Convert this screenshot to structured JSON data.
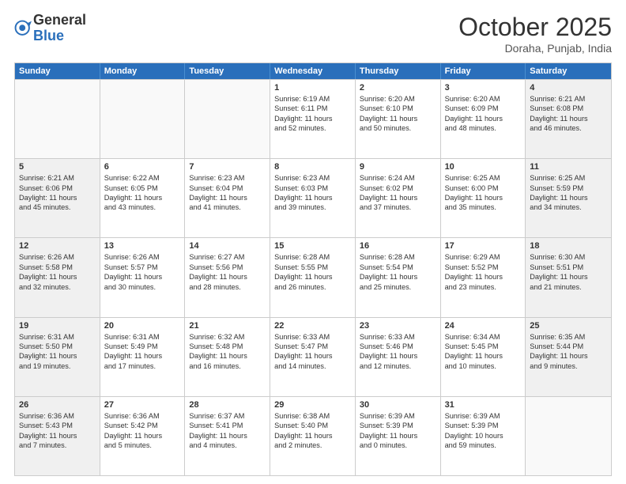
{
  "header": {
    "logo_general": "General",
    "logo_blue": "Blue",
    "month": "October 2025",
    "location": "Doraha, Punjab, India"
  },
  "weekdays": [
    "Sunday",
    "Monday",
    "Tuesday",
    "Wednesday",
    "Thursday",
    "Friday",
    "Saturday"
  ],
  "rows": [
    [
      {
        "day": "",
        "empty": true,
        "lines": []
      },
      {
        "day": "",
        "empty": true,
        "lines": []
      },
      {
        "day": "",
        "empty": true,
        "lines": []
      },
      {
        "day": "1",
        "empty": false,
        "lines": [
          "Sunrise: 6:19 AM",
          "Sunset: 6:11 PM",
          "Daylight: 11 hours",
          "and 52 minutes."
        ]
      },
      {
        "day": "2",
        "empty": false,
        "lines": [
          "Sunrise: 6:20 AM",
          "Sunset: 6:10 PM",
          "Daylight: 11 hours",
          "and 50 minutes."
        ]
      },
      {
        "day": "3",
        "empty": false,
        "lines": [
          "Sunrise: 6:20 AM",
          "Sunset: 6:09 PM",
          "Daylight: 11 hours",
          "and 48 minutes."
        ]
      },
      {
        "day": "4",
        "empty": false,
        "shaded": true,
        "lines": [
          "Sunrise: 6:21 AM",
          "Sunset: 6:08 PM",
          "Daylight: 11 hours",
          "and 46 minutes."
        ]
      }
    ],
    [
      {
        "day": "5",
        "empty": false,
        "shaded": true,
        "lines": [
          "Sunrise: 6:21 AM",
          "Sunset: 6:06 PM",
          "Daylight: 11 hours",
          "and 45 minutes."
        ]
      },
      {
        "day": "6",
        "empty": false,
        "lines": [
          "Sunrise: 6:22 AM",
          "Sunset: 6:05 PM",
          "Daylight: 11 hours",
          "and 43 minutes."
        ]
      },
      {
        "day": "7",
        "empty": false,
        "lines": [
          "Sunrise: 6:23 AM",
          "Sunset: 6:04 PM",
          "Daylight: 11 hours",
          "and 41 minutes."
        ]
      },
      {
        "day": "8",
        "empty": false,
        "lines": [
          "Sunrise: 6:23 AM",
          "Sunset: 6:03 PM",
          "Daylight: 11 hours",
          "and 39 minutes."
        ]
      },
      {
        "day": "9",
        "empty": false,
        "lines": [
          "Sunrise: 6:24 AM",
          "Sunset: 6:02 PM",
          "Daylight: 11 hours",
          "and 37 minutes."
        ]
      },
      {
        "day": "10",
        "empty": false,
        "lines": [
          "Sunrise: 6:25 AM",
          "Sunset: 6:00 PM",
          "Daylight: 11 hours",
          "and 35 minutes."
        ]
      },
      {
        "day": "11",
        "empty": false,
        "shaded": true,
        "lines": [
          "Sunrise: 6:25 AM",
          "Sunset: 5:59 PM",
          "Daylight: 11 hours",
          "and 34 minutes."
        ]
      }
    ],
    [
      {
        "day": "12",
        "empty": false,
        "shaded": true,
        "lines": [
          "Sunrise: 6:26 AM",
          "Sunset: 5:58 PM",
          "Daylight: 11 hours",
          "and 32 minutes."
        ]
      },
      {
        "day": "13",
        "empty": false,
        "lines": [
          "Sunrise: 6:26 AM",
          "Sunset: 5:57 PM",
          "Daylight: 11 hours",
          "and 30 minutes."
        ]
      },
      {
        "day": "14",
        "empty": false,
        "lines": [
          "Sunrise: 6:27 AM",
          "Sunset: 5:56 PM",
          "Daylight: 11 hours",
          "and 28 minutes."
        ]
      },
      {
        "day": "15",
        "empty": false,
        "lines": [
          "Sunrise: 6:28 AM",
          "Sunset: 5:55 PM",
          "Daylight: 11 hours",
          "and 26 minutes."
        ]
      },
      {
        "day": "16",
        "empty": false,
        "lines": [
          "Sunrise: 6:28 AM",
          "Sunset: 5:54 PM",
          "Daylight: 11 hours",
          "and 25 minutes."
        ]
      },
      {
        "day": "17",
        "empty": false,
        "lines": [
          "Sunrise: 6:29 AM",
          "Sunset: 5:52 PM",
          "Daylight: 11 hours",
          "and 23 minutes."
        ]
      },
      {
        "day": "18",
        "empty": false,
        "shaded": true,
        "lines": [
          "Sunrise: 6:30 AM",
          "Sunset: 5:51 PM",
          "Daylight: 11 hours",
          "and 21 minutes."
        ]
      }
    ],
    [
      {
        "day": "19",
        "empty": false,
        "shaded": true,
        "lines": [
          "Sunrise: 6:31 AM",
          "Sunset: 5:50 PM",
          "Daylight: 11 hours",
          "and 19 minutes."
        ]
      },
      {
        "day": "20",
        "empty": false,
        "lines": [
          "Sunrise: 6:31 AM",
          "Sunset: 5:49 PM",
          "Daylight: 11 hours",
          "and 17 minutes."
        ]
      },
      {
        "day": "21",
        "empty": false,
        "lines": [
          "Sunrise: 6:32 AM",
          "Sunset: 5:48 PM",
          "Daylight: 11 hours",
          "and 16 minutes."
        ]
      },
      {
        "day": "22",
        "empty": false,
        "lines": [
          "Sunrise: 6:33 AM",
          "Sunset: 5:47 PM",
          "Daylight: 11 hours",
          "and 14 minutes."
        ]
      },
      {
        "day": "23",
        "empty": false,
        "lines": [
          "Sunrise: 6:33 AM",
          "Sunset: 5:46 PM",
          "Daylight: 11 hours",
          "and 12 minutes."
        ]
      },
      {
        "day": "24",
        "empty": false,
        "lines": [
          "Sunrise: 6:34 AM",
          "Sunset: 5:45 PM",
          "Daylight: 11 hours",
          "and 10 minutes."
        ]
      },
      {
        "day": "25",
        "empty": false,
        "shaded": true,
        "lines": [
          "Sunrise: 6:35 AM",
          "Sunset: 5:44 PM",
          "Daylight: 11 hours",
          "and 9 minutes."
        ]
      }
    ],
    [
      {
        "day": "26",
        "empty": false,
        "shaded": true,
        "lines": [
          "Sunrise: 6:36 AM",
          "Sunset: 5:43 PM",
          "Daylight: 11 hours",
          "and 7 minutes."
        ]
      },
      {
        "day": "27",
        "empty": false,
        "lines": [
          "Sunrise: 6:36 AM",
          "Sunset: 5:42 PM",
          "Daylight: 11 hours",
          "and 5 minutes."
        ]
      },
      {
        "day": "28",
        "empty": false,
        "lines": [
          "Sunrise: 6:37 AM",
          "Sunset: 5:41 PM",
          "Daylight: 11 hours",
          "and 4 minutes."
        ]
      },
      {
        "day": "29",
        "empty": false,
        "lines": [
          "Sunrise: 6:38 AM",
          "Sunset: 5:40 PM",
          "Daylight: 11 hours",
          "and 2 minutes."
        ]
      },
      {
        "day": "30",
        "empty": false,
        "lines": [
          "Sunrise: 6:39 AM",
          "Sunset: 5:39 PM",
          "Daylight: 11 hours",
          "and 0 minutes."
        ]
      },
      {
        "day": "31",
        "empty": false,
        "lines": [
          "Sunrise: 6:39 AM",
          "Sunset: 5:39 PM",
          "Daylight: 10 hours",
          "and 59 minutes."
        ]
      },
      {
        "day": "",
        "empty": true,
        "lines": []
      }
    ]
  ]
}
